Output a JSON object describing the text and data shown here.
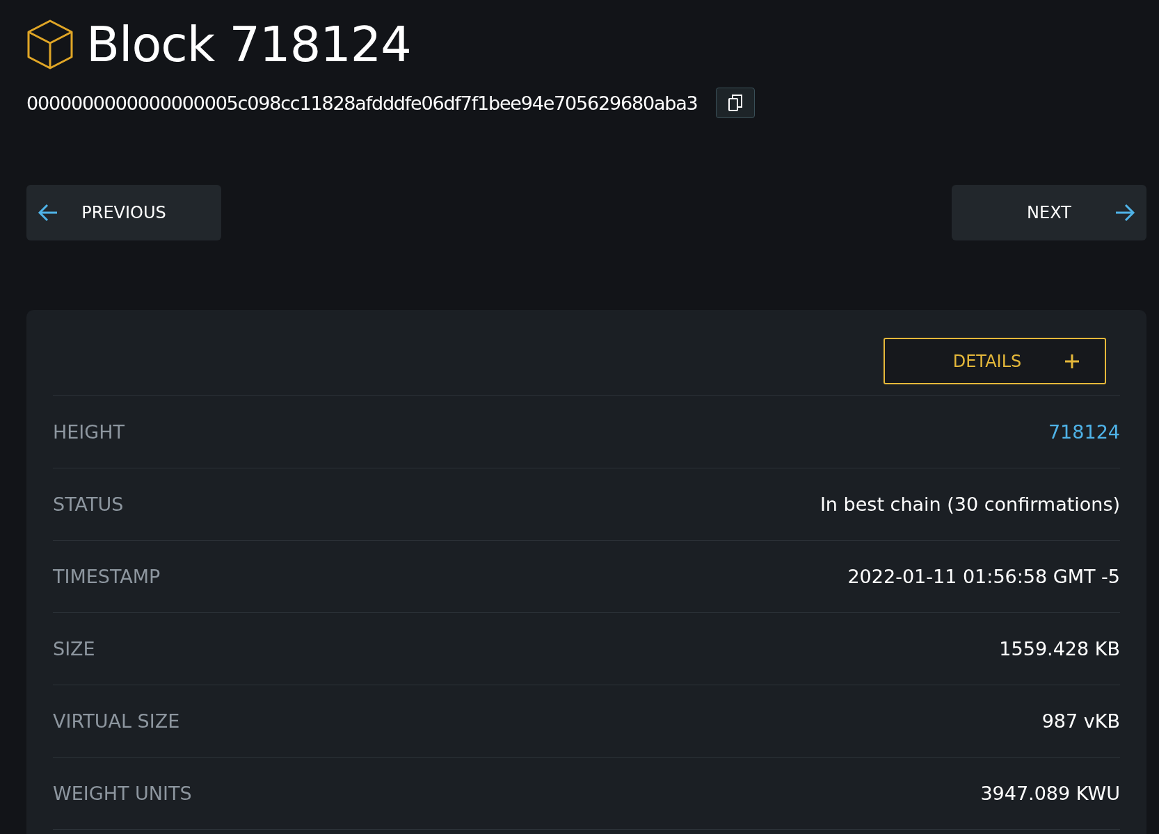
{
  "title": "Block 718124",
  "hash": "0000000000000000005c098cc11828afdddfe06df7f1bee94e705629680aba3",
  "nav": {
    "previous": "PREVIOUS",
    "next": "NEXT"
  },
  "details_button": "DETAILS",
  "rows": [
    {
      "label": "HEIGHT",
      "value": "718124",
      "kind": "link"
    },
    {
      "label": "STATUS",
      "value": "In best chain (30 confirmations)",
      "kind": "text"
    },
    {
      "label": "TIMESTAMP",
      "value": "2022-01-11 01:56:58 GMT -5",
      "kind": "text"
    },
    {
      "label": "SIZE",
      "value": "1559.428 KB",
      "kind": "text"
    },
    {
      "label": "VIRTUAL SIZE",
      "value": "987 vKB",
      "kind": "text"
    },
    {
      "label": "WEIGHT UNITS",
      "value": "3947.089 KWU",
      "kind": "text"
    }
  ]
}
